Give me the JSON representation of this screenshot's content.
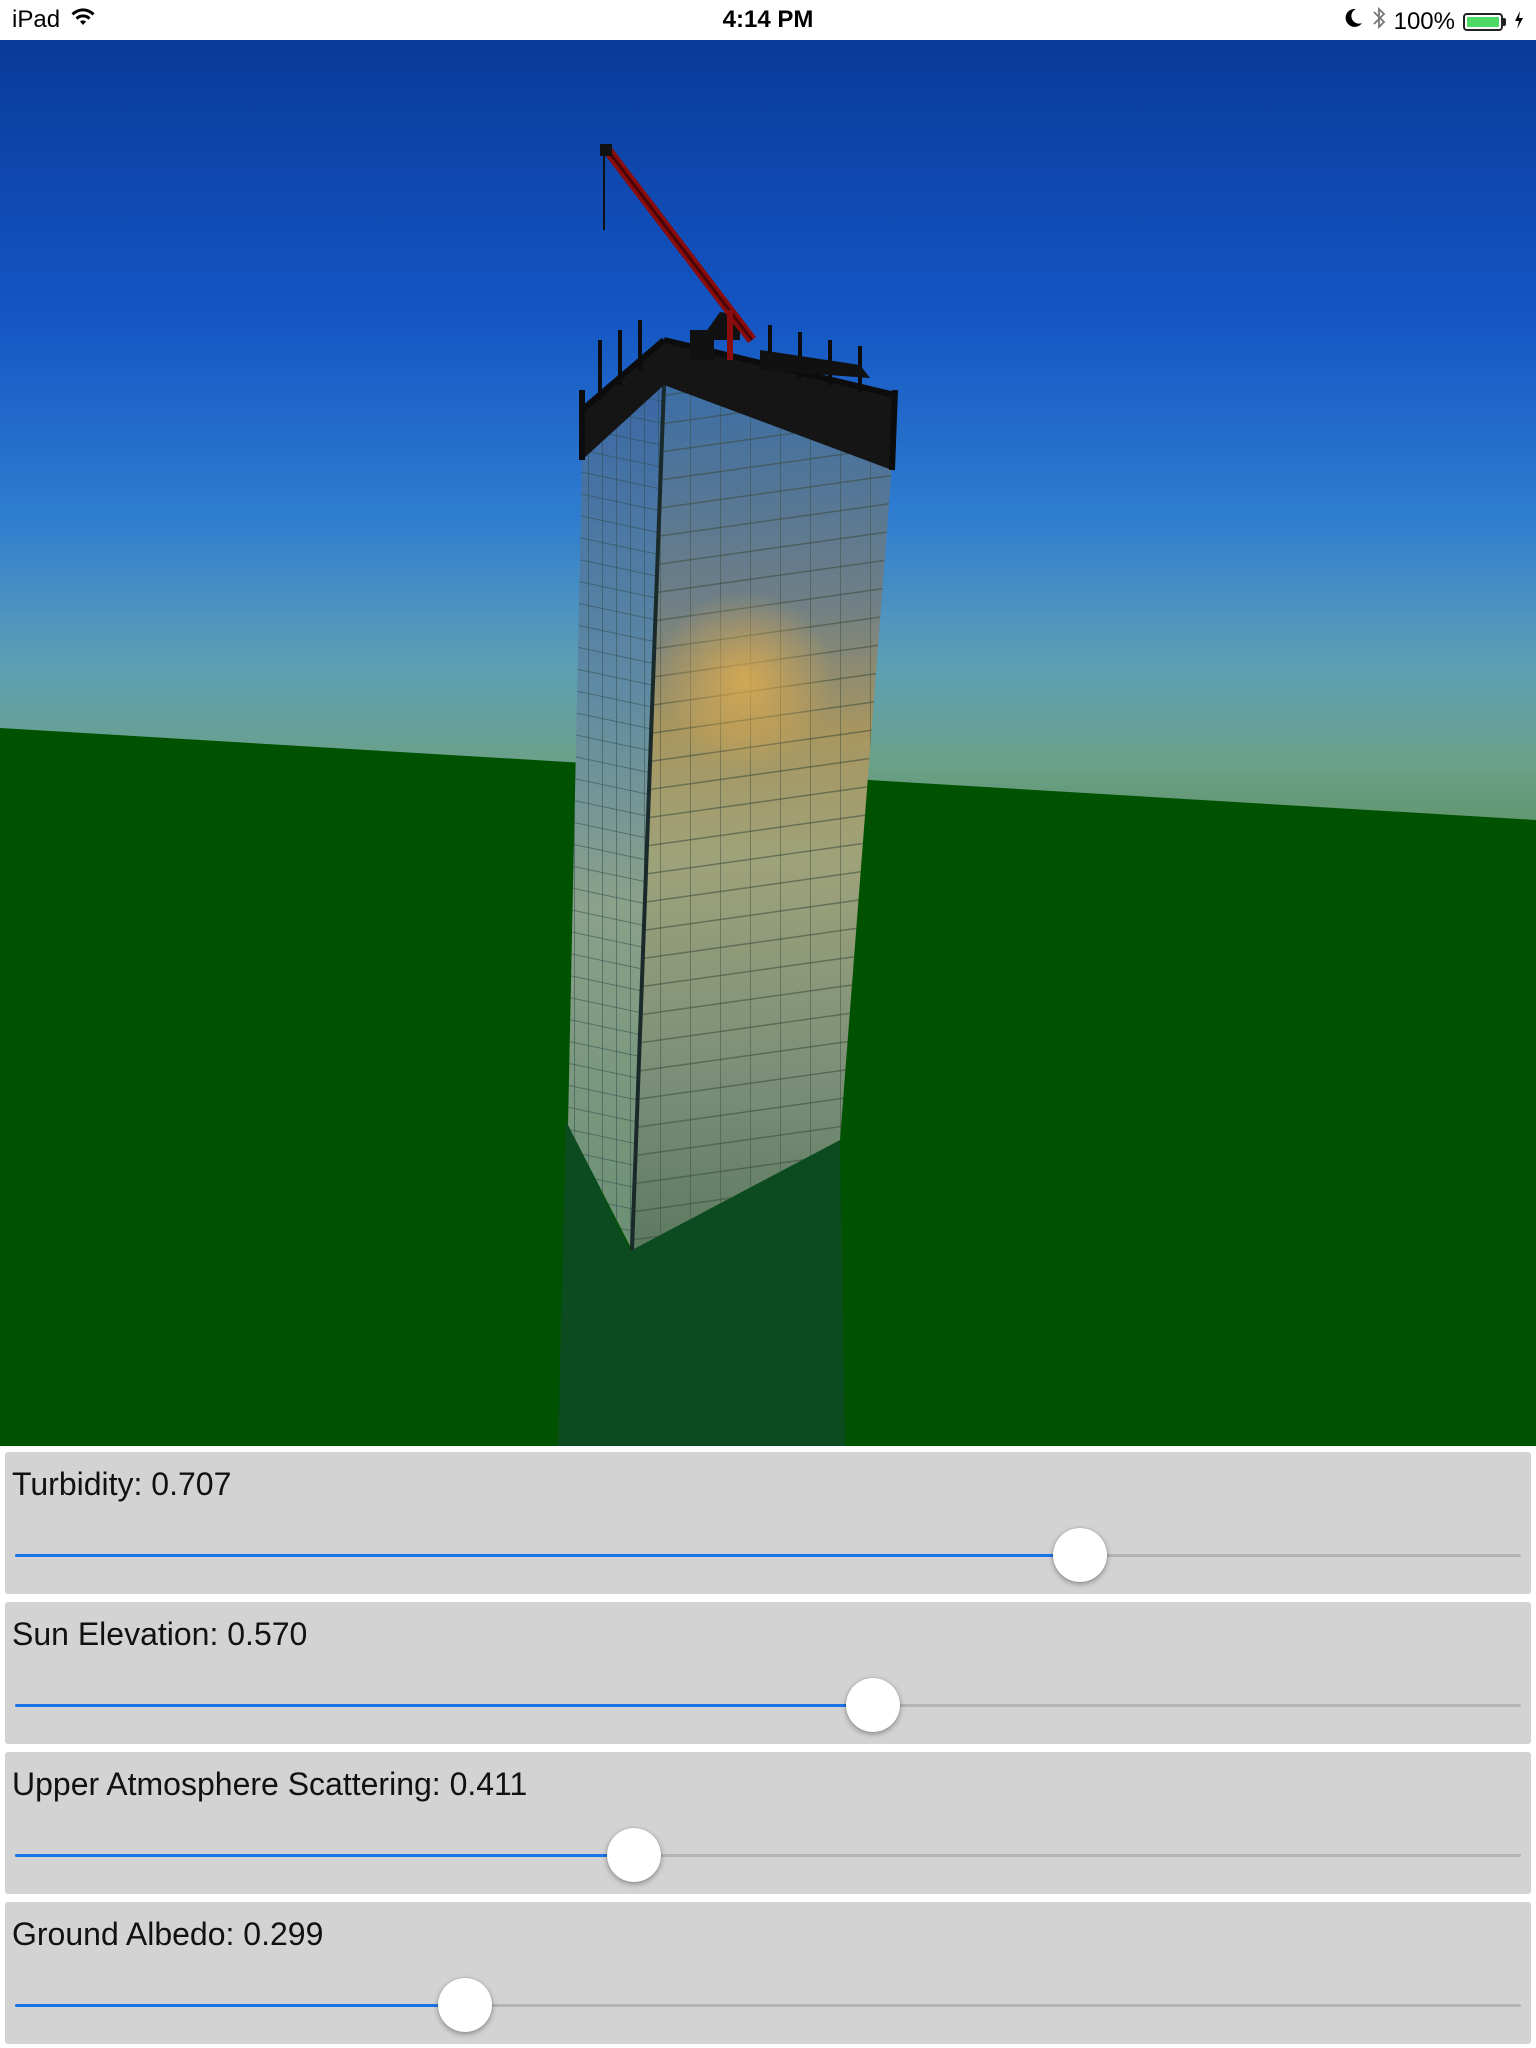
{
  "status_bar": {
    "device": "iPad",
    "time": "4:14 PM",
    "battery": "100%",
    "icons": [
      "wifi-icon",
      "moon-icon",
      "bluetooth-icon",
      "battery-icon",
      "charging-icon"
    ]
  },
  "scene": {
    "description_icons": [
      "sky-gradient",
      "ground-plane",
      "building-model",
      "crane"
    ],
    "colors": {
      "sky_top": "#0a3a9a",
      "sky_horizon": "#5f9e85",
      "ground": "#005200",
      "crane": "#8a0c0c",
      "slider_active": "#1a74e8"
    }
  },
  "controls": [
    {
      "label": "Turbidity: 0.707",
      "value": 0.707
    },
    {
      "label": "Sun Elevation: 0.570",
      "value": 0.57
    },
    {
      "label": "Upper Atmosphere Scattering: 0.411",
      "value": 0.411
    },
    {
      "label": "Ground Albedo: 0.299",
      "value": 0.299
    }
  ]
}
